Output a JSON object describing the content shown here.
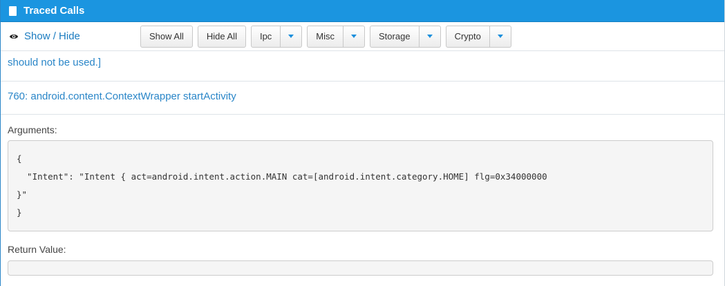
{
  "panel": {
    "title": "Traced Calls"
  },
  "toolbar": {
    "show_hide_label": "Show / Hide",
    "show_all_label": "Show All",
    "hide_all_label": "Hide All",
    "filters": [
      {
        "label": "Ipc"
      },
      {
        "label": "Misc"
      },
      {
        "label": "Storage"
      },
      {
        "label": "Crypto"
      }
    ]
  },
  "content": {
    "previous_entry_tail": "should not be used.]",
    "call": {
      "header": "760: android.content.ContextWrapper startActivity",
      "arguments_label": "Arguments:",
      "arguments_text": "{\n  \"Intent\": \"Intent { act=android.intent.action.MAIN cat=[android.intent.category.HOME] flg=0x34000000\n}\"\n}",
      "return_label": "Return Value:",
      "return_value": ""
    }
  },
  "colors": {
    "titlebar": "#1b95e0",
    "link": "#2a86c8",
    "caret": "#1b8fdc"
  },
  "icons": {
    "title": "book-icon",
    "show_hide": "eye-icon",
    "dropdown": "caret-down-icon"
  }
}
